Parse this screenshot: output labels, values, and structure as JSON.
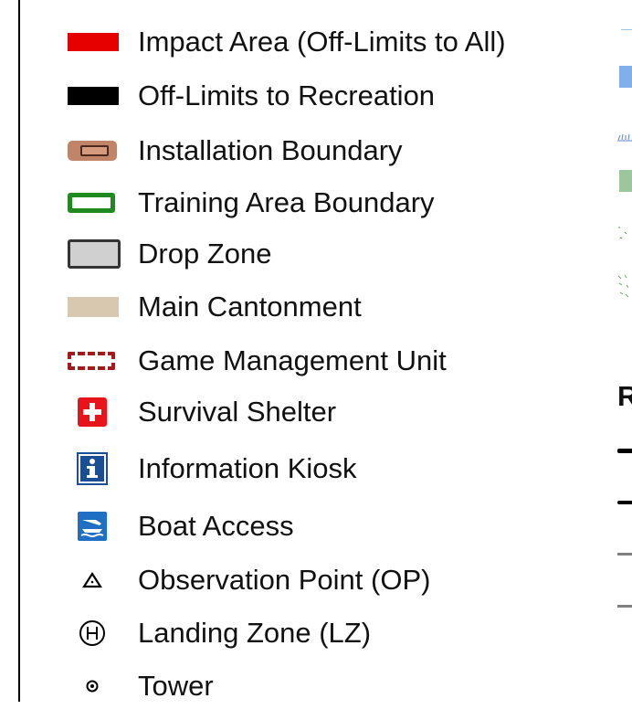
{
  "legend": {
    "items": [
      {
        "label": "Impact Area (Off-Limits to All)",
        "symbol": "red-fill-swatch",
        "color": "#e60000"
      },
      {
        "label": "Off-Limits to Recreation",
        "symbol": "black-fill-swatch",
        "color": "#000000"
      },
      {
        "label": "Installation Boundary",
        "symbol": "installation-boundary-swatch",
        "color": "#c08468"
      },
      {
        "label": "Training Area Boundary",
        "symbol": "green-outline-swatch",
        "color": "#1f8a1f"
      },
      {
        "label": "Drop Zone",
        "symbol": "gray-box-swatch",
        "color": "#d0d0d0"
      },
      {
        "label": "Main Cantonment",
        "symbol": "tan-fill-swatch",
        "color": "#d8c8b0"
      },
      {
        "label": "Game Management Unit",
        "symbol": "dashed-red-outline-swatch",
        "color": "#a41a1a"
      },
      {
        "label": "Survival Shelter",
        "symbol": "shelter-cross-icon",
        "color": "#e8141c"
      },
      {
        "label": "Information Kiosk",
        "symbol": "info-icon",
        "color": "#1a4f96"
      },
      {
        "label": "Boat Access",
        "symbol": "boat-access-icon",
        "color": "#1f6fc4"
      },
      {
        "label": "Observation Point (OP)",
        "symbol": "triangle-icon",
        "color": "#000000"
      },
      {
        "label": "Landing Zone (LZ)",
        "symbol": "helipad-icon",
        "color": "#000000"
      },
      {
        "label": "Tower",
        "symbol": "tower-icon",
        "color": "#000000"
      }
    ]
  },
  "right_panel": {
    "heading_fragment": "R"
  }
}
